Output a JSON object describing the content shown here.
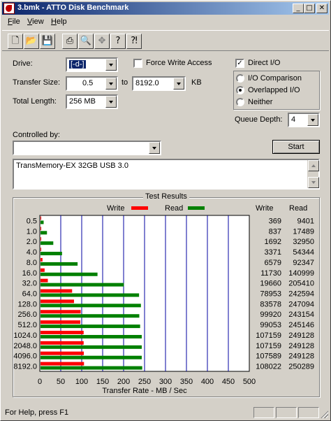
{
  "window": {
    "title": "3.bmk - ATTO Disk Benchmark"
  },
  "menu": [
    "File",
    "View",
    "Help"
  ],
  "toolbar": [
    "new-icon",
    "open-icon",
    "save-icon",
    "print-icon",
    "print-preview-icon",
    "move-icon",
    "help-icon",
    "context-help-icon"
  ],
  "settings": {
    "drive_label": "Drive:",
    "drive_value": "[-d-]",
    "force_write_label": "Force Write Access",
    "force_write_checked": false,
    "direct_io_label": "Direct I/O",
    "direct_io_checked": true,
    "transfer_size_label": "Transfer Size:",
    "transfer_from": "0.5",
    "to_label": "to",
    "transfer_to": "8192.0",
    "kb_label": "KB",
    "total_length_label": "Total Length:",
    "total_length_value": "256 MB",
    "io_modes": [
      "I/O Comparison",
      "Overlapped I/O",
      "Neither"
    ],
    "io_mode_selected": "Overlapped I/O",
    "queue_depth_label": "Queue Depth:",
    "queue_depth_value": "4",
    "controlled_by_label": "Controlled by:",
    "controlled_by_value": "",
    "start_label": "Start",
    "device_text": "TransMemory-EX 32GB USB 3.0"
  },
  "results": {
    "title": "Test Results",
    "legend_write": "Write",
    "legend_read": "Read",
    "col_write": "Write",
    "col_read": "Read"
  },
  "colors": {
    "write": "#ff0000",
    "read": "#008000",
    "gridline": "#0000a0"
  },
  "chart_data": {
    "type": "bar",
    "orientation": "horizontal",
    "categories": [
      "0.5",
      "1.0",
      "2.0",
      "4.0",
      "8.0",
      "16.0",
      "32.0",
      "64.0",
      "128.0",
      "256.0",
      "512.0",
      "1024.0",
      "2048.0",
      "4096.0",
      "8192.0"
    ],
    "series": [
      {
        "name": "Write",
        "values": [
          369,
          837,
          1692,
          3371,
          6579,
          11730,
          19660,
          78953,
          83578,
          99920,
          99053,
          107159,
          107159,
          107589,
          108022
        ]
      },
      {
        "name": "Read",
        "values": [
          9401,
          17489,
          32950,
          54344,
          92347,
          140999,
          205410,
          242594,
          247094,
          243154,
          245146,
          249128,
          249128,
          249128,
          250289
        ]
      }
    ],
    "xlabel": "Transfer Rate - MB / Sec",
    "xlim": [
      0,
      500
    ],
    "xticks": [
      "0",
      "50",
      "100",
      "150",
      "200",
      "250",
      "300",
      "350",
      "400",
      "450",
      "500"
    ],
    "grid": true,
    "legend": "top-center"
  },
  "statusbar": {
    "text": "For Help, press F1"
  }
}
